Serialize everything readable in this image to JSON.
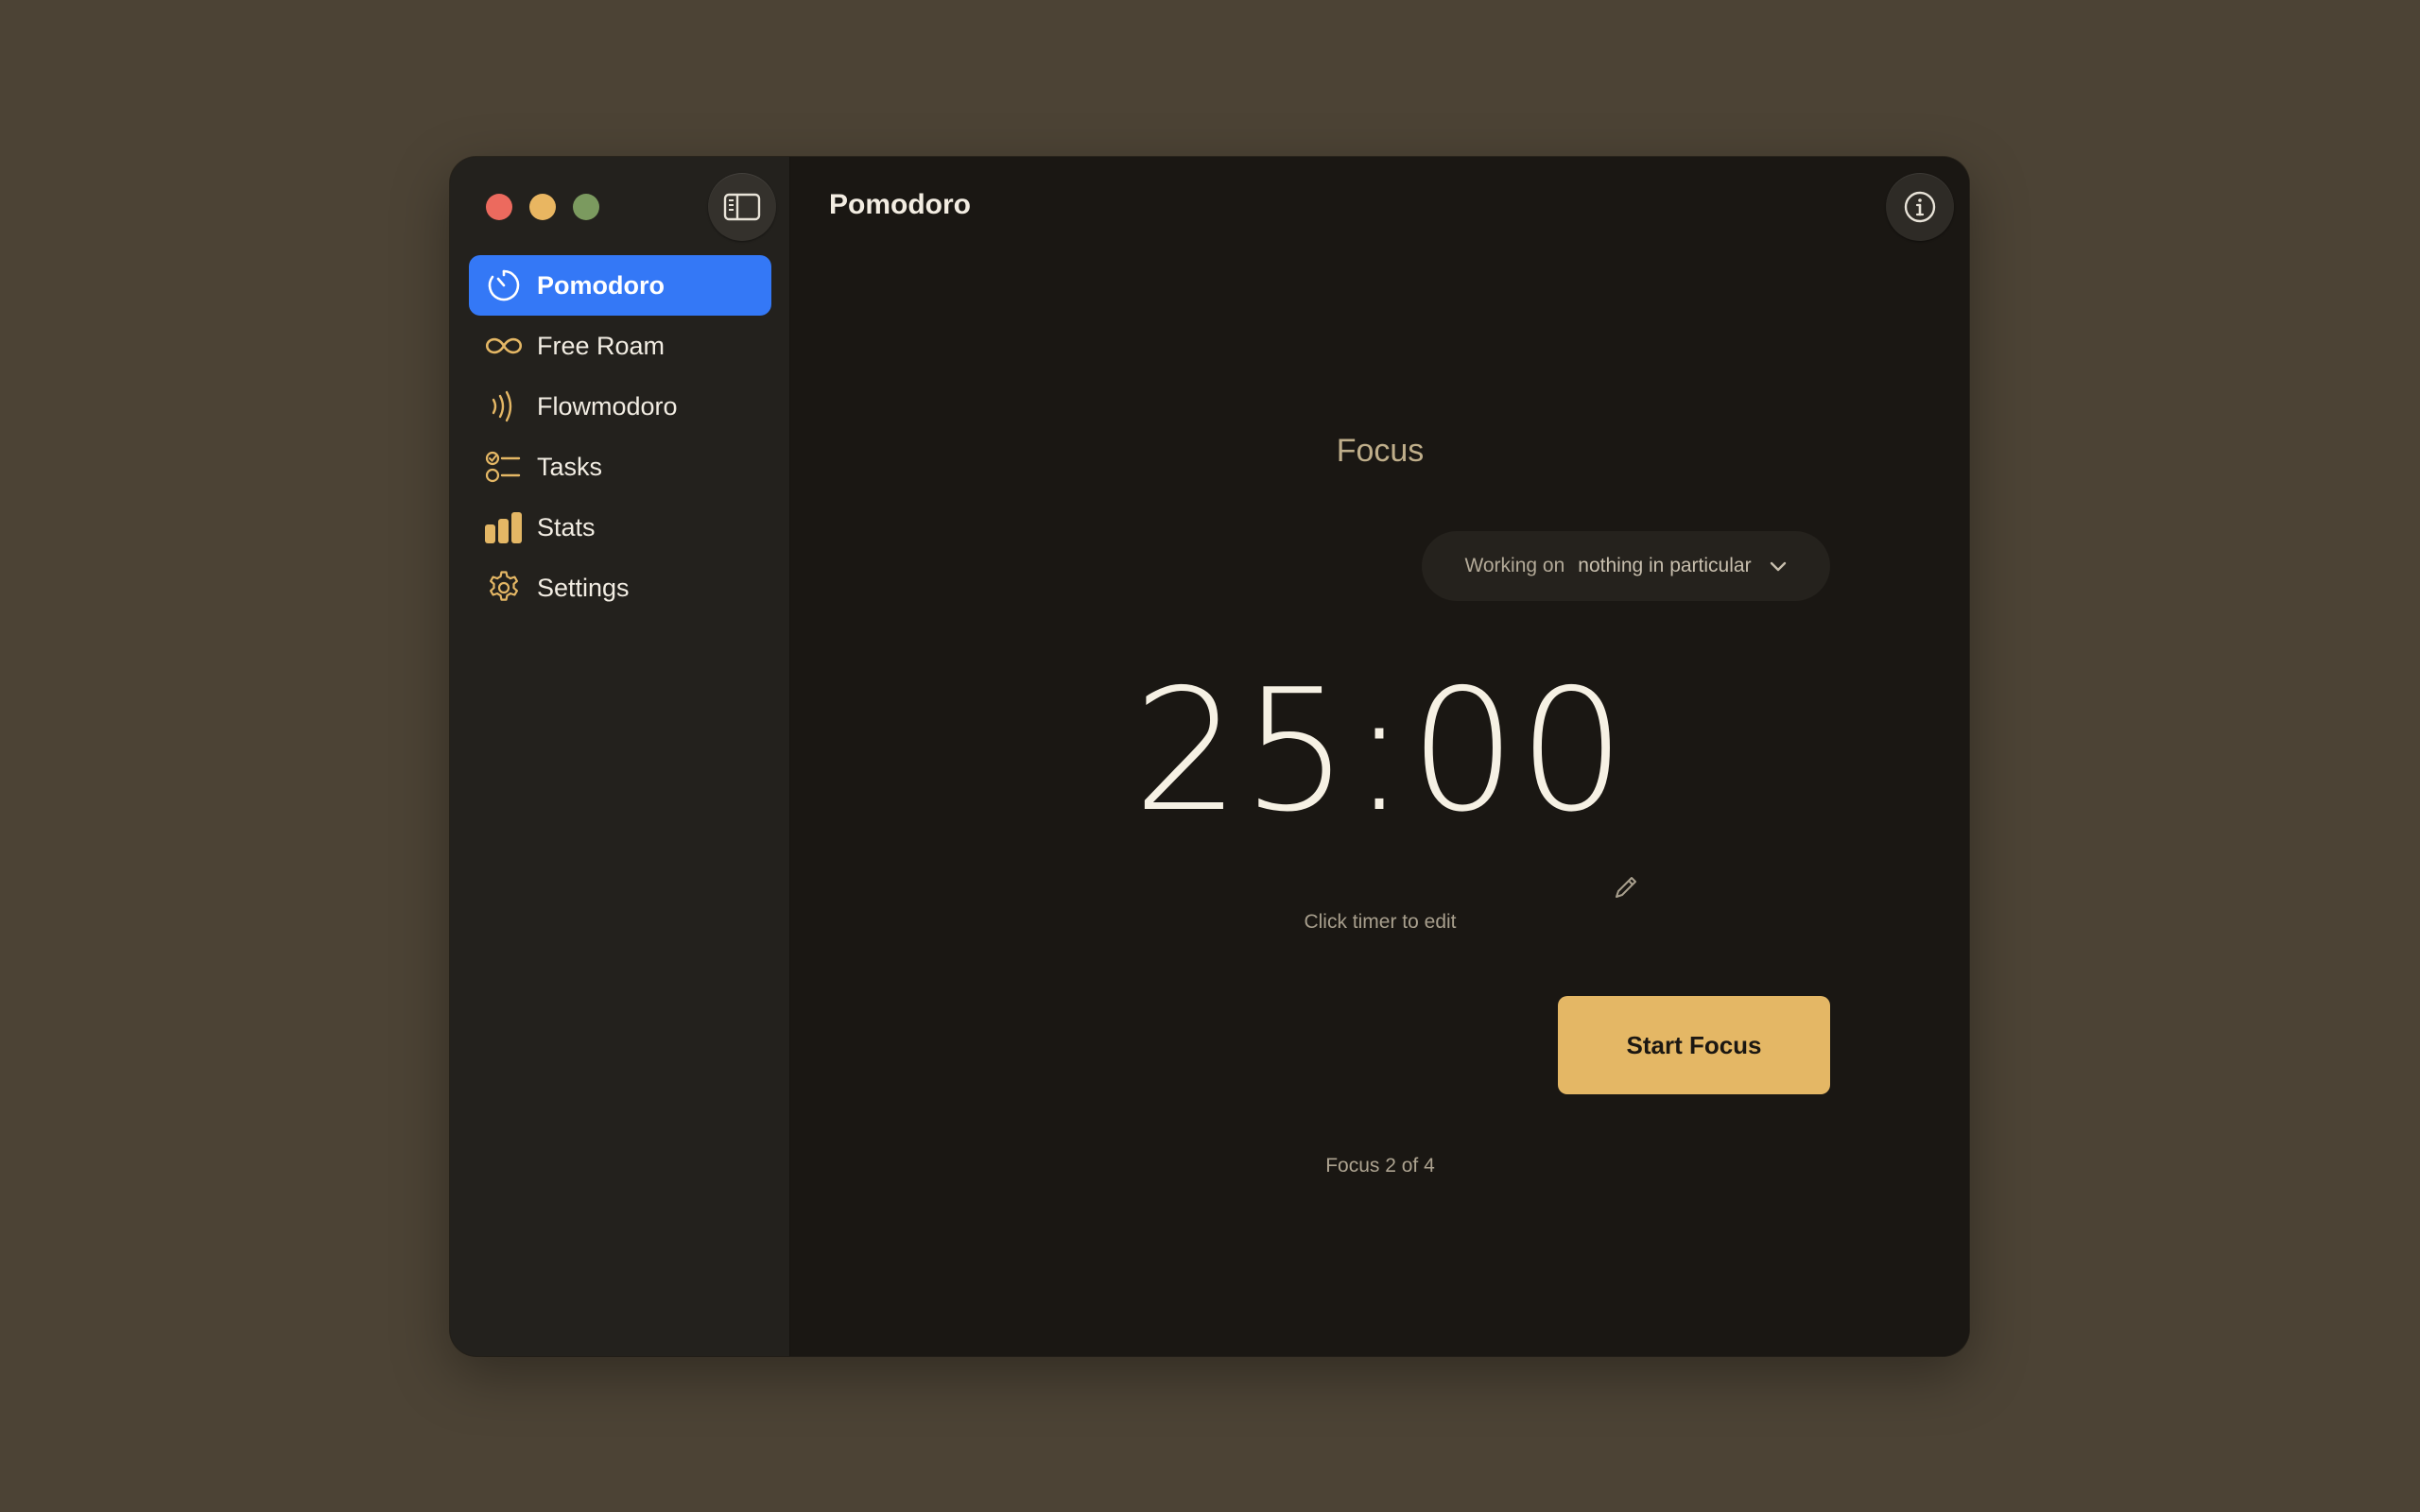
{
  "window": {
    "controls": [
      "close",
      "minimize",
      "zoom"
    ]
  },
  "sidebar": {
    "toggle_icon": "sidebar-toggle-icon",
    "items": [
      {
        "label": "Pomodoro",
        "icon": "timer-icon",
        "active": true
      },
      {
        "label": "Free Roam",
        "icon": "infinity-icon",
        "active": false
      },
      {
        "label": "Flowmodoro",
        "icon": "waves-icon",
        "active": false
      },
      {
        "label": "Tasks",
        "icon": "checklist-icon",
        "active": false
      },
      {
        "label": "Stats",
        "icon": "bar-chart-icon",
        "active": false
      },
      {
        "label": "Settings",
        "icon": "gear-icon",
        "active": false
      }
    ]
  },
  "main": {
    "title": "Pomodoro",
    "info_icon": "info-icon",
    "mode_label": "Focus",
    "working_on": {
      "prefix": "Working on",
      "value": "nothing in particular"
    },
    "timer": "25:00",
    "edit_hint": "Click timer to edit",
    "start_button": "Start Focus",
    "session_count": "Focus 2 of 4"
  },
  "colors": {
    "accent_blue": "#3478f6",
    "accent_gold": "#e4b765",
    "background": "#4c4335",
    "window_bg": "#1a1713",
    "sidebar_bg": "#23211d"
  }
}
